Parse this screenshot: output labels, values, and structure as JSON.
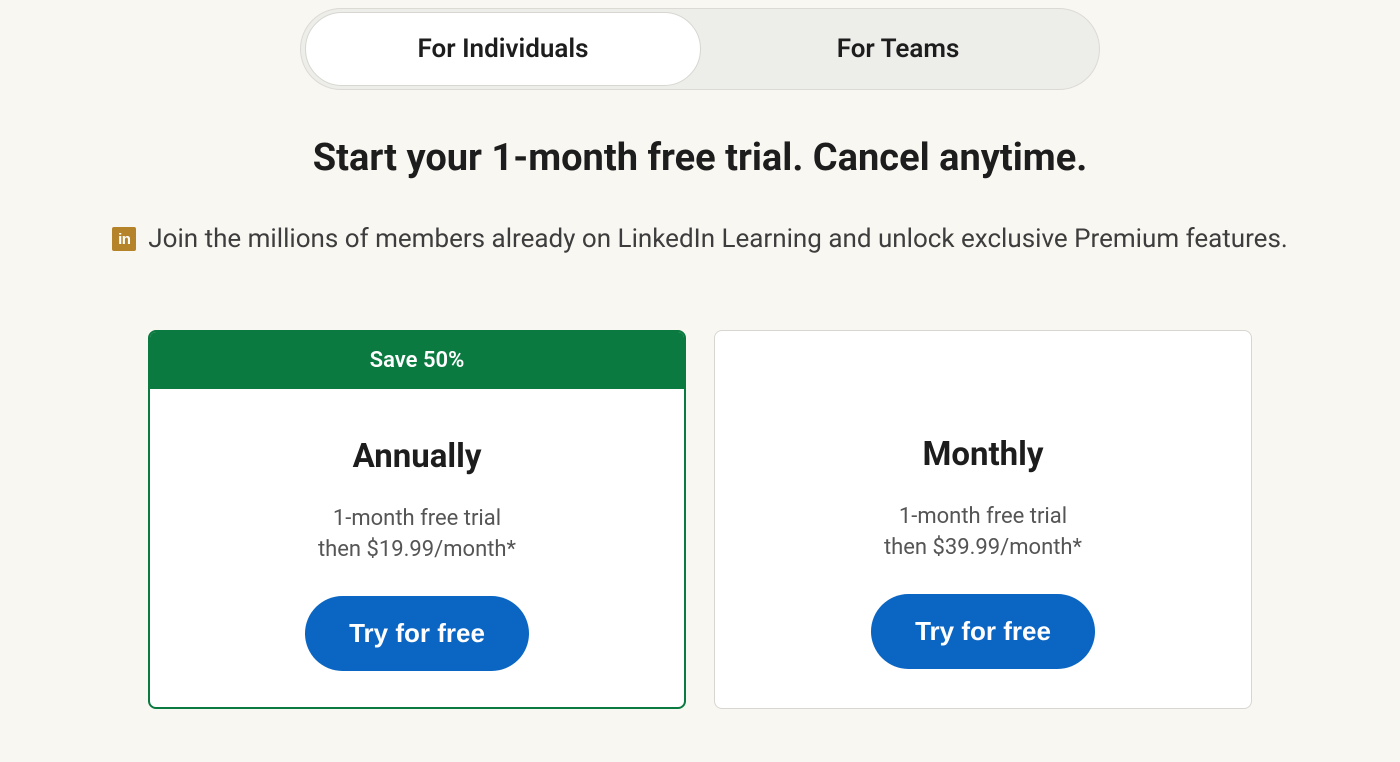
{
  "tabs": {
    "individuals": "For Individuals",
    "teams": "For Teams"
  },
  "headline": "Start your 1-month free trial. Cancel anytime.",
  "linkedin_icon_label": "in",
  "subtext": "Join the millions of members already on LinkedIn Learning and unlock exclusive Premium features.",
  "plans": {
    "annual": {
      "banner": "Save 50%",
      "title": "Annually",
      "line1": "1-month free trial",
      "line2": "then $19.99/month*",
      "cta": "Try for free"
    },
    "monthly": {
      "title": "Monthly",
      "line1": "1-month free trial",
      "line2": "then $39.99/month*",
      "cta": "Try for free"
    }
  }
}
